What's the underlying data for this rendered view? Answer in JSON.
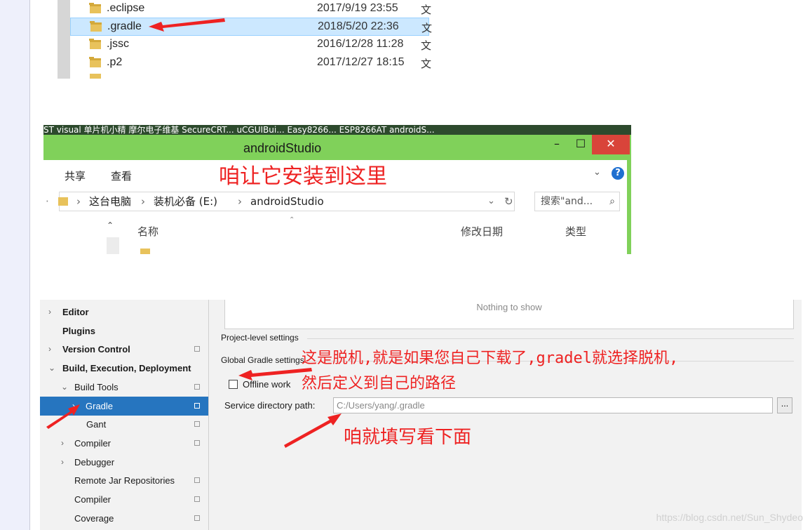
{
  "explorer_list": {
    "rows": [
      {
        "name": ".eclipse",
        "date": "2017/9/19 23:55",
        "type": "文"
      },
      {
        "name": ".gradle",
        "date": "2018/5/20 22:36",
        "type": "文"
      },
      {
        "name": ".jssc",
        "date": "2016/12/28 11:28",
        "type": "文"
      },
      {
        "name": ".p2",
        "date": "2017/12/27 18:15",
        "type": "文"
      }
    ]
  },
  "explorer_window": {
    "bookmarks": "ST visual   单片机小精   摩尔电子维基   SecureCRT...   uCGUIBui...   Easy8266...   ESP8266AT   androidS...",
    "title": "androidStudio",
    "ribbon": [
      "共享",
      "查看"
    ],
    "breadcrumb": [
      "这台电脑",
      "装机必备 (E:)",
      "androidStudio"
    ],
    "search_placeholder": "搜索\"and...",
    "columns": [
      "名称",
      "修改日期",
      "类型"
    ]
  },
  "settings": {
    "sidebar": [
      {
        "label": "Editor",
        "chevron": "›",
        "bold": true
      },
      {
        "label": "Plugins",
        "chevron": "",
        "bold": true
      },
      {
        "label": "Version Control",
        "chevron": "›",
        "bold": true,
        "copy": true
      },
      {
        "label": "Build, Execution, Deployment",
        "chevron": "⌄",
        "bold": true
      },
      {
        "label": "Build Tools",
        "chevron": "⌄",
        "bold": false,
        "copy": true
      },
      {
        "label": "Gradle",
        "chevron": "›",
        "bold": false,
        "copy": true,
        "selected": true
      },
      {
        "label": "Gant",
        "chevron": "",
        "bold": false,
        "copy": true
      },
      {
        "label": "Compiler",
        "chevron": "›",
        "bold": false,
        "copy": true
      },
      {
        "label": "Debugger",
        "chevron": "›",
        "bold": false
      },
      {
        "label": "Remote Jar Repositories",
        "chevron": "",
        "bold": false,
        "copy": true
      },
      {
        "label": "Compiler",
        "chevron": "",
        "bold": false,
        "copy": true
      },
      {
        "label": "Coverage",
        "chevron": "",
        "bold": false,
        "copy": true
      }
    ],
    "nothing_to_show": "Nothing to show",
    "project_level": "Project-level settings",
    "global_gradle": "Global Gradle settings",
    "offline_work": "Offline work",
    "service_dir_label": "Service directory path:",
    "service_dir_value": "C:/Users/yang/.gradle",
    "browse_label": "..."
  },
  "annotations": {
    "install_here": "咱让它安装到这里",
    "offline_line1": "这是脱机,就是如果您自己下载了,gradel就选择脱机,",
    "offline_line2": "然后定义到自己的路径",
    "fill_below": "咱就填写看下面"
  },
  "watermark": "https://blog.csdn.net/Sun_Shydeo",
  "colors": {
    "annotation": "#ee2222",
    "titlebar": "#80d15a",
    "selection": "#2675bf"
  }
}
